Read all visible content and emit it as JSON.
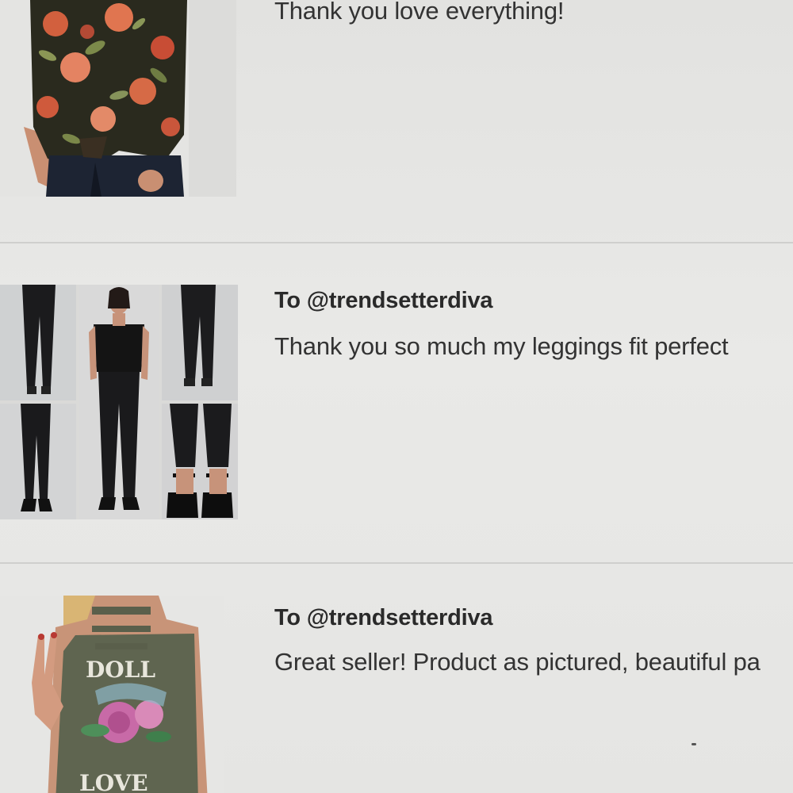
{
  "reviews": [
    {
      "recipient": "",
      "message": "Thank you love everything!",
      "product_image": "floral-top-photo"
    },
    {
      "recipient": "To @trendsetterdiva",
      "message": "Thank you so much my leggings fit perfect",
      "product_image": "leggings-photo-grid"
    },
    {
      "recipient": "To @trendsetterdiva",
      "message": "Great seller! Product as pictured, beautiful pa",
      "product_image": "doll-love-tank-photo",
      "product_image_text": [
        "DOLL",
        "LOVE"
      ]
    }
  ],
  "colors": {
    "background": "#e6e6e4",
    "divider": "#cfcfcd",
    "text": "#333333"
  }
}
